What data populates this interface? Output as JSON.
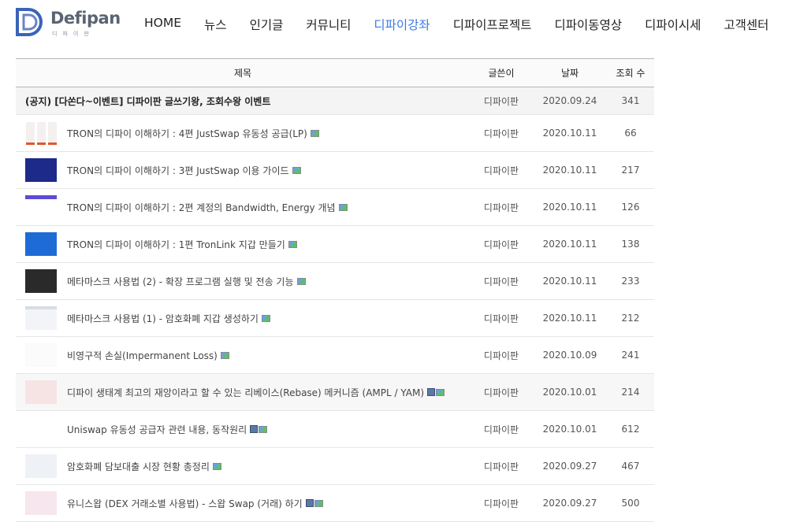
{
  "logo": {
    "name": "Defipan",
    "sub": "디파이판"
  },
  "nav": [
    "HOME",
    "뉴스",
    "인기글",
    "커뮤니티",
    "디파이강좌",
    "디파이프로젝트",
    "디파이동영상",
    "디파이시세",
    "고객센터"
  ],
  "nav_active_index": 4,
  "table": {
    "headers": {
      "title": "제목",
      "author": "글쓴이",
      "date": "날짜",
      "views": "조회 수"
    },
    "notice": {
      "title": "(공지) [다쏜다~이벤트] 디파이판 글쓰기왕, 조회수왕 이벤트",
      "author": "디파이판",
      "date": "2020.09.24",
      "views": "341"
    },
    "rows": [
      {
        "title": "TRON의 디파이 이해하기 : 4편 JustSwap 유동성 공급(LP)",
        "author": "디파이판",
        "date": "2020.10.11",
        "views": "66",
        "icons": [
          "image-icon"
        ]
      },
      {
        "title": "TRON의 디파이 이해하기 : 3편 JustSwap 이용 가이드",
        "author": "디파이판",
        "date": "2020.10.11",
        "views": "217",
        "icons": [
          "image-icon"
        ]
      },
      {
        "title": "TRON의 디파이 이해하기 : 2편 계정의 Bandwidth, Energy 개념",
        "author": "디파이판",
        "date": "2020.10.11",
        "views": "126",
        "icons": [
          "image-icon"
        ]
      },
      {
        "title": "TRON의 디파이 이해하기 : 1편 TronLink 지갑 만들기",
        "author": "디파이판",
        "date": "2020.10.11",
        "views": "138",
        "icons": [
          "image-icon"
        ]
      },
      {
        "title": "메타마스크 사용법 (2) - 확장 프로그램 실행 및 전송 기능",
        "author": "디파이판",
        "date": "2020.10.11",
        "views": "233",
        "icons": [
          "image-icon"
        ]
      },
      {
        "title": "메타마스크 사용법 (1) - 암호화폐 지갑 생성하기",
        "author": "디파이판",
        "date": "2020.10.11",
        "views": "212",
        "icons": [
          "image-icon"
        ]
      },
      {
        "title": "비영구적 손실(Impermanent Loss)",
        "author": "디파이판",
        "date": "2020.10.09",
        "views": "241",
        "icons": [
          "image-icon"
        ]
      },
      {
        "title": "디파이 생태계 최고의 재앙이라고 할 수 있는 리베이스(Rebase) 메커니즘 (AMPL / YAM)",
        "author": "디파이판",
        "date": "2020.10.01",
        "views": "214",
        "icons": [
          "file-icon",
          "image-icon"
        ]
      },
      {
        "title": "Uniswap 유동성 공급자 관련 내용, 동작원리",
        "author": "디파이판",
        "date": "2020.10.01",
        "views": "612",
        "icons": [
          "file-icon",
          "image-icon"
        ]
      },
      {
        "title": "암호화폐 담보대출 시장 현황 총정리",
        "author": "디파이판",
        "date": "2020.09.27",
        "views": "467",
        "icons": [
          "image-icon"
        ]
      },
      {
        "title": "유니스왑 (DEX 거래소별 사용법) - 스왑 Swap (거래) 하기",
        "author": "디파이판",
        "date": "2020.09.27",
        "views": "500",
        "icons": [
          "file-icon",
          "image-icon"
        ]
      }
    ]
  },
  "colors": {
    "nav_active": "#3d7be0",
    "logo_blue": "#3b63b8"
  }
}
